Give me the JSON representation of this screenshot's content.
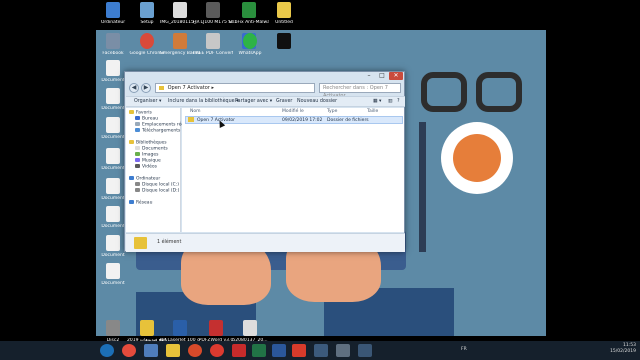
{
  "desktop": {
    "top_icons": [
      {
        "label": "Ordinateur",
        "color": "#3d7dd0"
      },
      {
        "label": "Setup",
        "color": "#6aa0d0"
      },
      {
        "label": "IMG_20180115_...",
        "color": "#dcdcdc"
      },
      {
        "label": "HP LJ100 M175 Scan",
        "color": "#5b5b5b"
      },
      {
        "label": "UsbFix Anti-Malware",
        "color": "#2a8f3d"
      },
      {
        "label": "Untitled",
        "color": "#e9c84a"
      }
    ],
    "row2_icons": [
      {
        "label": "Facebook",
        "color": "#7a8ea6"
      },
      {
        "label": "Google Chrome",
        "color": "#d94a3a"
      },
      {
        "label": "Emergency Backup",
        "color": "#d07b3a"
      },
      {
        "label": "FREE PDF Converter",
        "color": "#c7c7c7"
      },
      {
        "label": "",
        "color": "#3a6ad0"
      },
      {
        "label": "WhatsApp",
        "color": "#2eb346"
      },
      {
        "label": "",
        "color": "#101010"
      }
    ],
    "left_icons": [
      {
        "label": "Document",
        "color": "#f2f2f2"
      },
      {
        "label": "Document",
        "color": "#f2f2f2"
      },
      {
        "label": "Document",
        "color": "#f2f2f2"
      },
      {
        "label": "Document",
        "color": "#f2f2f2"
      },
      {
        "label": "Document",
        "color": "#f2f2f2"
      },
      {
        "label": "Document",
        "color": "#f2f2f2"
      },
      {
        "label": "Document",
        "color": "#f2f2f2"
      },
      {
        "label": "Document",
        "color": "#f2f2f2"
      }
    ],
    "bottom_icons": [
      {
        "label": "Disc2",
        "color": "#888"
      },
      {
        "label": "مقاطع فيديوهات 2019",
        "color": "#e7c23a"
      },
      {
        "label": "HP LaserJet 100 color MFP M17...",
        "color": "#2a5fa8"
      },
      {
        "label": "PDFZWord v3.0",
        "color": "#c43030"
      },
      {
        "label": "52080137_20...",
        "color": "#ddd"
      }
    ]
  },
  "window": {
    "address": "Open 7 Activator",
    "search_placeholder": "Rechercher dans : Open 7 Activator",
    "toolbar": {
      "organize": "Organiser ▾",
      "include": "Inclure dans la bibliothèque ▾",
      "share": "Partager avec ▾",
      "burn": "Graver",
      "new_folder": "Nouveau dossier"
    },
    "nav": {
      "favorites": "Favoris",
      "desktop": "Bureau",
      "recent": "Emplacements récents",
      "downloads": "Téléchargements",
      "libraries": "Bibliothèques",
      "documents": "Documents",
      "images": "Images",
      "music": "Musique",
      "videos": "Vidéos",
      "computer": "Ordinateur",
      "disk_c": "Disque local (C:)",
      "disk_d": "Disque local (D:)",
      "network": "Réseau"
    },
    "columns": {
      "name": "Nom",
      "modified": "Modifié le",
      "type": "Type",
      "size": "Taille"
    },
    "rows": [
      {
        "name": "Open 7 Activator",
        "modified": "09/02/2019 17:02",
        "type": "Dossier de fichiers",
        "size": ""
      }
    ],
    "details_text": "1 élément"
  },
  "taskbar": {
    "lang": "FR",
    "time": "11:53",
    "date": "15/02/2019"
  }
}
